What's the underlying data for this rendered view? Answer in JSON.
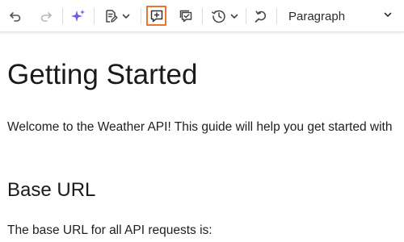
{
  "toolbar": {
    "block_format": "Paragraph",
    "icons": [
      "undo-icon",
      "redo-icon",
      "ai-sparkle-icon",
      "edit-document-icon",
      "chevron-down-icon",
      "add-comment-icon",
      "comment-check-icon",
      "history-icon",
      "chevron-down-icon",
      "find-replace-icon",
      "chevron-down-icon"
    ],
    "highlight_color": "#e8752a",
    "sparkle_color": "#6b5cf0"
  },
  "document": {
    "title": "Getting Started",
    "intro": "Welcome to the Weather API! This guide will help you get started with",
    "section_heading": "Base URL",
    "section_text": "The base URL for all API requests is:"
  }
}
